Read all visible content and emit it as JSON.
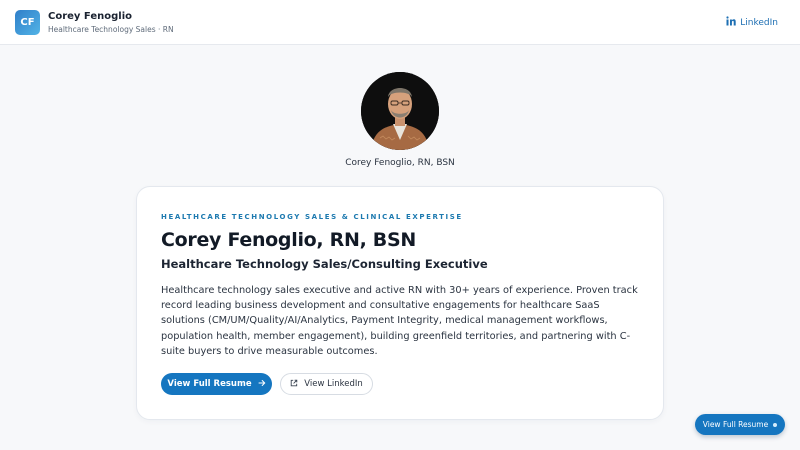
{
  "header": {
    "logo_initials": "CF",
    "name": "Corey Fenoglio",
    "subtitle": "Healthcare Technology Sales · RN",
    "linkedin_label": "LinkedIn"
  },
  "profile": {
    "caption": "Corey Fenoglio, RN, BSN"
  },
  "card": {
    "eyebrow": "HEALTHCARE TECHNOLOGY SALES & CLINICAL EXPERTISE",
    "headline": "Corey Fenoglio, RN, BSN",
    "subheadline": "Healthcare Technology Sales/Consulting Executive",
    "summary": "Healthcare technology sales executive and active RN with 30+ years of experience. Proven track record leading business development and consultative engagements for healthcare SaaS solutions (CM/UM/Quality/AI/Analytics, Payment Integrity, medical management workflows, population health, member engagement), building greenfield territories, and partnering with C-suite buyers to drive measurable outcomes.",
    "primary_button": "View Full Resume",
    "secondary_button": "View LinkedIn"
  },
  "floating": {
    "button_label": "View Full Resume"
  },
  "colors": {
    "accent": "#1576c0",
    "eyebrow": "#1d7ab0",
    "logo_gradient_start": "#2f7fc9",
    "logo_gradient_end": "#52b3e6"
  }
}
